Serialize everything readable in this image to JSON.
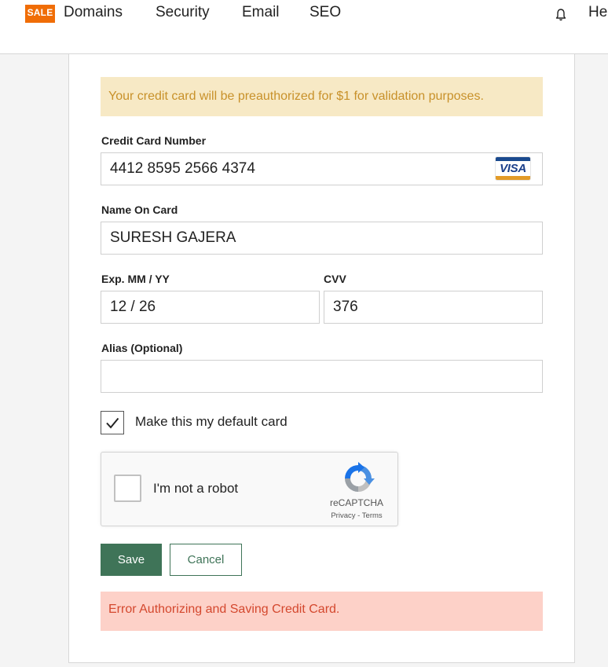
{
  "nav": {
    "sale_badge": "SALE",
    "items": [
      "Domains",
      "Security",
      "Email",
      "SEO"
    ],
    "help_partial": "He",
    "bell_icon": "bell-icon"
  },
  "form": {
    "preauth_notice": "Your credit card will be preauthorized for $1 for validation purposes.",
    "card_number": {
      "label": "Credit Card Number",
      "value": "4412 8595 2566 4374",
      "brand": "VISA"
    },
    "name_on_card": {
      "label": "Name On Card",
      "value": "SURESH GAJERA"
    },
    "expiry": {
      "label": "Exp. MM / YY",
      "value": "12 / 26"
    },
    "cvv": {
      "label": "CVV",
      "value": "376"
    },
    "alias": {
      "label": "Alias (Optional)",
      "value": ""
    },
    "default_card": {
      "label": "Make this my default card",
      "checked": true
    },
    "recaptcha": {
      "label": "I'm not a robot",
      "brand": "reCAPTCHA",
      "privacy": "Privacy",
      "separator": " - ",
      "terms": "Terms"
    },
    "save_label": "Save",
    "cancel_label": "Cancel",
    "error_message": "Error Authorizing and Saving Credit Card."
  },
  "colors": {
    "sale": "#f06d06",
    "primary": "#3f7458",
    "notice_bg": "#f7e9c5",
    "notice_text": "#c8912a",
    "error_bg": "#fdd1c8",
    "error_text": "#d4482e"
  }
}
